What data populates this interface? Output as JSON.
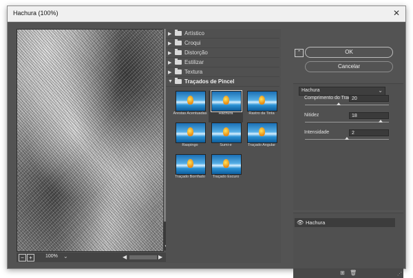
{
  "window": {
    "title": "Hachura (100%)",
    "close_glyph": "✕"
  },
  "preview": {
    "zoom": "100%",
    "zoom_out": "−",
    "zoom_in": "+"
  },
  "gallery": {
    "categories": [
      {
        "label": "Artístico",
        "expanded": false
      },
      {
        "label": "Croqui",
        "expanded": false
      },
      {
        "label": "Distorção",
        "expanded": false
      },
      {
        "label": "Estilizar",
        "expanded": false
      },
      {
        "label": "Textura",
        "expanded": false
      },
      {
        "label": "Traçados de Pincel",
        "expanded": true
      }
    ],
    "filters": [
      {
        "label": "Arestas Acentuadas",
        "selected": false
      },
      {
        "label": "Hachura",
        "selected": true
      },
      {
        "label": "Rastro da Tinta",
        "selected": false
      },
      {
        "label": "Raspingo",
        "selected": false
      },
      {
        "label": "Sumi-e",
        "selected": false
      },
      {
        "label": "Traçado Angular",
        "selected": false
      },
      {
        "label": "Traçado Borrifado",
        "selected": false
      },
      {
        "label": "Traçado Escuro",
        "selected": false
      }
    ]
  },
  "buttons": {
    "ok": "OK",
    "cancel": "Cancelar"
  },
  "settings": {
    "filter_select": "Hachura",
    "params": [
      {
        "label": "Comprimento do Traçado",
        "value": "20",
        "fraction": 0.4
      },
      {
        "label": "Nitidez",
        "value": "18",
        "fraction": 0.9
      },
      {
        "label": "Intensidade",
        "value": "2",
        "fraction": 0.5
      }
    ]
  },
  "layers": {
    "items": [
      {
        "name": "Hachura"
      }
    ],
    "new_icon": "⊞",
    "delete_icon": "🗑"
  },
  "icons": {
    "eye": "eye-icon",
    "folder": "folder-icon",
    "expand": "triangle-right-icon",
    "collapse": "triangle-down-icon"
  },
  "colors": {
    "dialog_bg": "#535353",
    "panel_bg": "#505050",
    "text": "#e2e2e2"
  }
}
